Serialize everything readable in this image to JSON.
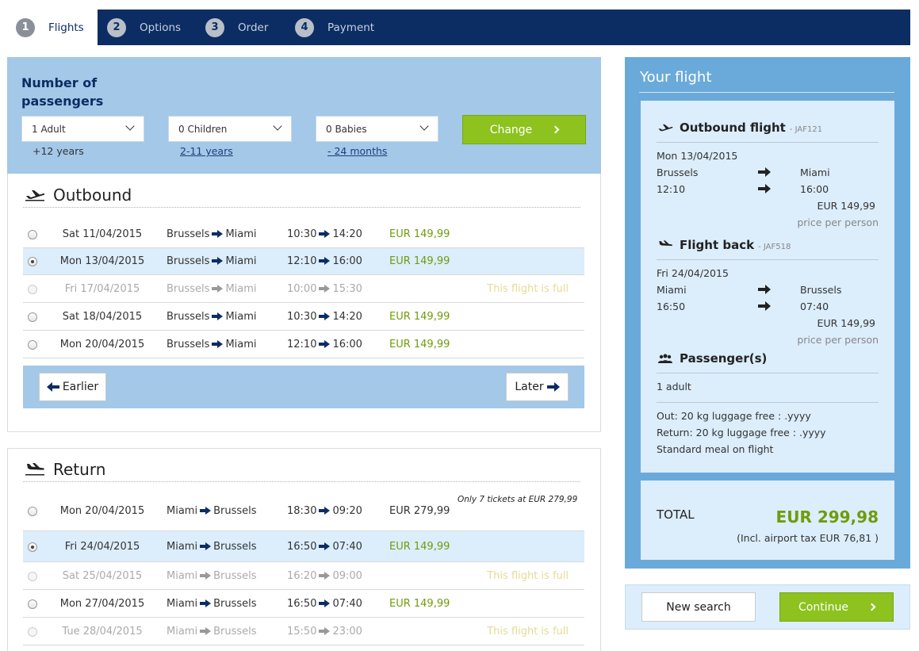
{
  "steps": [
    {
      "num": "1",
      "label": "Flights"
    },
    {
      "num": "2",
      "label": "Options"
    },
    {
      "num": "3",
      "label": "Order"
    },
    {
      "num": "4",
      "label": "Payment"
    }
  ],
  "passengers": {
    "title": "Number of passengers",
    "adults": {
      "value": "1 Adult",
      "sub": "+12 years"
    },
    "children": {
      "value": "0 Children",
      "sub": "2-11 years"
    },
    "babies": {
      "value": "0 Babies",
      "sub": "- 24 months"
    },
    "change_label": "Change"
  },
  "outbound": {
    "title": "Outbound",
    "rows": [
      {
        "date": "Sat 11/04/2015",
        "from": "Brussels",
        "to": "Miami",
        "dep": "10:30",
        "arr": "14:20",
        "price": "EUR 149,99",
        "note": "",
        "state": "normal"
      },
      {
        "date": "Mon 13/04/2015",
        "from": "Brussels",
        "to": "Miami",
        "dep": "12:10",
        "arr": "16:00",
        "price": "EUR 149,99",
        "note": "",
        "state": "selected"
      },
      {
        "date": "Fri 17/04/2015",
        "from": "Brussels",
        "to": "Miami",
        "dep": "10:00",
        "arr": "15:30",
        "price": "",
        "note": "This flight is full",
        "state": "full"
      },
      {
        "date": "Sat 18/04/2015",
        "from": "Brussels",
        "to": "Miami",
        "dep": "10:30",
        "arr": "14:20",
        "price": "EUR 149,99",
        "note": "",
        "state": "normal"
      },
      {
        "date": "Mon 20/04/2015",
        "from": "Brussels",
        "to": "Miami",
        "dep": "12:10",
        "arr": "16:00",
        "price": "EUR 149,99",
        "note": "",
        "state": "normal"
      }
    ],
    "earlier_label": "Earlier",
    "later_label": "Later"
  },
  "return": {
    "title": "Return",
    "rows": [
      {
        "date": "Mon 20/04/2015",
        "from": "Miami",
        "to": "Brussels",
        "dep": "18:30",
        "arr": "09:20",
        "price": "EUR 279,99",
        "note": "Only 7 tickets at EUR 279,99",
        "state": "normal"
      },
      {
        "date": "Fri 24/04/2015",
        "from": "Miami",
        "to": "Brussels",
        "dep": "16:50",
        "arr": "07:40",
        "price": "EUR 149,99",
        "note": "",
        "state": "selected"
      },
      {
        "date": "Sat 25/04/2015",
        "from": "Miami",
        "to": "Brussels",
        "dep": "16:20",
        "arr": "09:00",
        "price": "",
        "note": "This flight is full",
        "state": "full"
      },
      {
        "date": "Mon 27/04/2015",
        "from": "Miami",
        "to": "Brussels",
        "dep": "16:50",
        "arr": "07:40",
        "price": "EUR 149,99",
        "note": "",
        "state": "normal"
      },
      {
        "date": "Tue 28/04/2015",
        "from": "Miami",
        "to": "Brussels",
        "dep": "15:50",
        "arr": "23:00",
        "price": "",
        "note": "This flight is full",
        "state": "full"
      }
    ]
  },
  "summary": {
    "title": "Your flight",
    "outbound": {
      "heading": "Outbound flight",
      "code": "- JAF121",
      "date": "Mon 13/04/2015",
      "from": "Brussels",
      "to": "Miami",
      "dep": "12:10",
      "arr": "16:00",
      "price": "EUR 149,99",
      "price_note": "price per person"
    },
    "back": {
      "heading": "Flight back",
      "code": "- JAF518",
      "date": "Fri 24/04/2015",
      "from": "Miami",
      "to": "Brussels",
      "dep": "16:50",
      "arr": "07:40",
      "price": "EUR 149,99",
      "price_note": "price per person"
    },
    "passengers": {
      "heading": "Passenger(s)",
      "count": "1 adult"
    },
    "extras": [
      "Out: 20 kg luggage free : .yyyy",
      "Return: 20 kg luggage free : .yyyy",
      "Standard meal on flight"
    ],
    "total_label": "TOTAL",
    "total_value": "EUR 299,98",
    "tax_note": "(Incl. airport tax EUR 76,81 )"
  },
  "actions": {
    "new_search": "New search",
    "continue": "Continue"
  },
  "colors": {
    "navy": "#0c2d63",
    "green": "#8dc21f",
    "price_green": "#6f9c0b",
    "panel_blue": "#6aaadb",
    "light_blue": "#a3c8e8"
  }
}
